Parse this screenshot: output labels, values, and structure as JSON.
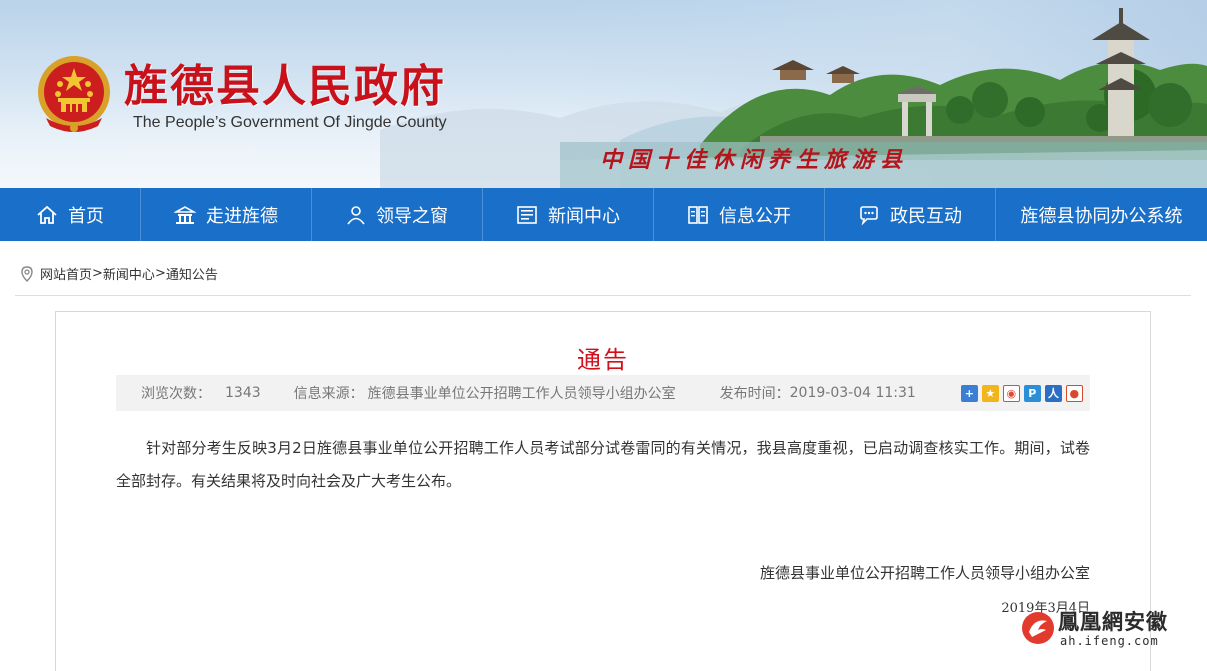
{
  "header": {
    "site_title": "旌德县人民政府",
    "site_subtitle": "The People’s Government Of Jingde County",
    "slogan": "中国十佳休闲养生旅游县",
    "emblem_icon": "national-emblem-icon",
    "title_color": "#c8111a"
  },
  "nav": {
    "background": "#1a6fc9",
    "items": [
      {
        "label": "首页",
        "icon": "home-icon"
      },
      {
        "label": "走进旌德",
        "icon": "pavilion-icon"
      },
      {
        "label": "领导之窗",
        "icon": "user-icon"
      },
      {
        "label": "新闻中心",
        "icon": "news-icon"
      },
      {
        "label": "信息公开",
        "icon": "book-icon"
      },
      {
        "label": "政民互动",
        "icon": "chat-icon"
      },
      {
        "label": "旌德县协同办公系统",
        "icon": ""
      }
    ]
  },
  "breadcrumb": {
    "icon": "location-pin-icon",
    "items": [
      "网站首页",
      "新闻中心",
      "通知公告"
    ],
    "separator": ">"
  },
  "article": {
    "title": "通告",
    "title_color": "#d0111b",
    "views_label": "浏览次数：",
    "views_value": "1343",
    "source_label": "信息来源：",
    "source_value": "旌德县事业单位公开招聘工作人员领导小组办公室",
    "time_label": "发布时间：",
    "time_value": "2019-03-04 11:31",
    "share_icons": [
      "share-more-icon",
      "qzone-icon",
      "weibo-icon",
      "tencent-weibo-icon",
      "renren-icon",
      "kaixin-icon"
    ],
    "body": "针对部分考生反映3月2日旌德县事业单位公开招聘工作人员考试部分试卷雷同的有关情况，我县高度重视，已启动调查核实工作。期间，试卷全部封存。有关结果将及时向社会及广大考生公布。",
    "signature_org": "旌德县事业单位公开招聘工作人员领导小组办公室",
    "signature_date": "2019年3月4日"
  },
  "watermark": {
    "name": "鳳凰網安徽",
    "url": "ah.ifeng.com",
    "icon": "ifeng-logo-icon"
  }
}
